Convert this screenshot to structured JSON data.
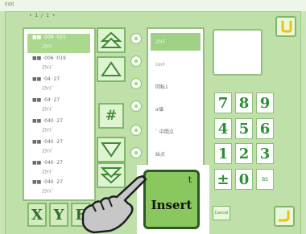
{
  "app": {
    "title": "Edit"
  },
  "header": {
    "label": "• 1 / 1 •"
  },
  "lines": [
    {
      "code": "■■ ·009 ·021",
      "sub": "ｽﾗｲﾄﾞ",
      "selected": true
    },
    {
      "code": "■■ ·006 ·019",
      "sub": "ｽﾗｲﾄﾞ",
      "selected": false
    },
    {
      "code": "■■ ·04 ·27",
      "sub": "ｽﾗｲﾄﾞ",
      "selected": false
    },
    {
      "code": "■■ ·04 ·27",
      "sub": "ｽﾗｲﾄﾞ",
      "selected": false
    },
    {
      "code": "■■ ·040 ·27",
      "sub": "ｽﾗｲﾄﾞ",
      "selected": false
    },
    {
      "code": "■■ ·040 ·27",
      "sub": "ｽﾗｲﾄﾞ",
      "selected": false
    },
    {
      "code": "■■ ·040 ·27",
      "sub": "ｽﾗｲﾄﾞ",
      "selected": false
    },
    {
      "code": "■■ ·040 ·27",
      "sub": "ｽﾗｲﾄﾞ",
      "selected": false
    }
  ],
  "options": [
    {
      "label": "ｽﾗｲﾄﾞ",
      "selected": true
    },
    {
      "label": "ｼｮｯﾄ",
      "selected": false
    },
    {
      "label": "回転1",
      "selected": false
    },
    {
      "label": "α値",
      "selected": false
    },
    {
      "label": "ﾞ 中間点",
      "selected": false
    },
    {
      "label": "始点",
      "selected": false
    }
  ],
  "controls": {
    "hash": "#"
  },
  "keypad": {
    "digits": [
      "7",
      "8",
      "9",
      "4",
      "5",
      "6",
      "1",
      "2",
      "3"
    ],
    "plus_minus": "±",
    "zero": "0",
    "backspace": "BS"
  },
  "axes": [
    "X",
    "Y",
    "F"
  ],
  "cancel_label": "Cancel",
  "insert": {
    "label": "Insert",
    "sub": "t"
  },
  "colors": {
    "accent": "#8ac75e",
    "background": "#c9e4b6",
    "text_green": "#2c8f33"
  }
}
